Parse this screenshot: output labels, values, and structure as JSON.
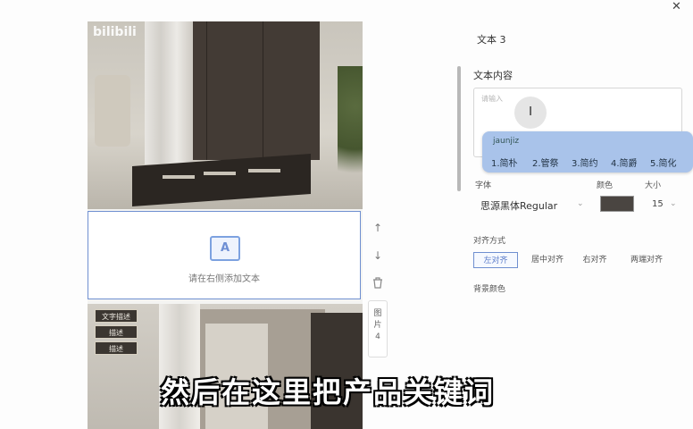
{
  "watermark": "bilibili",
  "preview": {
    "text_slot_hint": "请在右侧添加文本",
    "text_slot_icon": "A",
    "tags": [
      "文字描述",
      "描述",
      "描述"
    ]
  },
  "tools": {
    "up_icon": "arrow-up-icon",
    "down_icon": "arrow-down-icon",
    "delete_icon": "trash-icon",
    "image_btn": "图片4"
  },
  "panel": {
    "title": "文本 3",
    "content_label": "文本内容",
    "textarea_placeholder": "请输入",
    "ime": {
      "pinyin": "jaunjiz",
      "candidates": [
        "1.简朴",
        "2.管祭",
        "3.简约",
        "4.简爵",
        "5.简化"
      ]
    },
    "font_label": "字体",
    "font_value": "思源黑体Regular",
    "color_label": "颜色",
    "color_value": "#4a4541",
    "size_label": "大小",
    "size_value": "15",
    "align_label": "对齐方式",
    "align_options": [
      "左对齐",
      "居中对齐",
      "右对齐",
      "两端对齐"
    ],
    "align_selected": "左对齐",
    "bg_color_label": "背景颜色"
  },
  "subtitle": "然后在这里把产品关键词"
}
